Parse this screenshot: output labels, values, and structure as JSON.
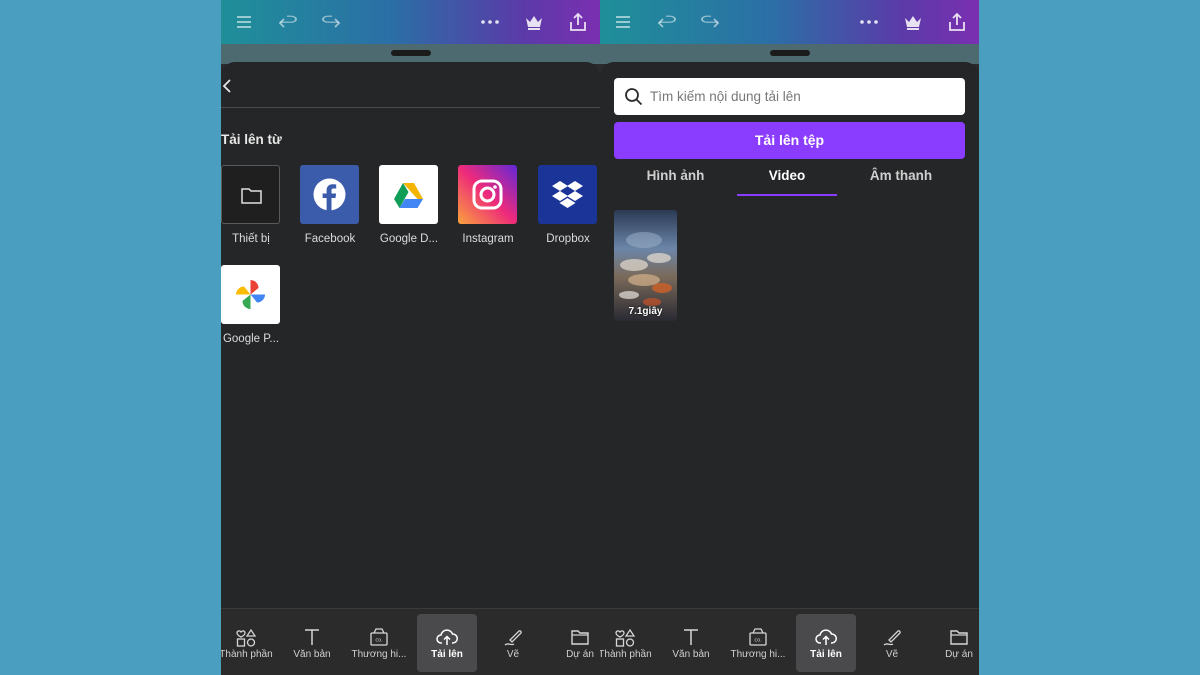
{
  "left_panel": {
    "section_title": "Tải lên từ",
    "sources": [
      {
        "label": "Thiết bị",
        "icon": "folder-icon"
      },
      {
        "label": "Facebook",
        "icon": "facebook-icon"
      },
      {
        "label": "Google D...",
        "icon": "google-drive-icon"
      },
      {
        "label": "Instagram",
        "icon": "instagram-icon"
      },
      {
        "label": "Dropbox",
        "icon": "dropbox-icon"
      },
      {
        "label": "Google P...",
        "icon": "google-photos-icon"
      }
    ]
  },
  "right_panel": {
    "search_placeholder": "Tìm kiếm nội dung tải lên",
    "upload_button": "Tải lên tệp",
    "tabs": [
      {
        "label": "Hình ảnh",
        "active": false
      },
      {
        "label": "Video",
        "active": true
      },
      {
        "label": "Âm thanh",
        "active": false
      }
    ],
    "videos": [
      {
        "duration": "7.1giây"
      }
    ]
  },
  "bottom_nav": {
    "items": [
      {
        "label": "Thành phần",
        "icon": "shapes-icon",
        "active": false
      },
      {
        "label": "Văn bản",
        "icon": "text-icon",
        "active": false
      },
      {
        "label": "Thương hi...",
        "icon": "brand-icon",
        "active": false
      },
      {
        "label": "Tải lên",
        "icon": "cloud-upload-icon",
        "active": true
      },
      {
        "label": "Vẽ",
        "icon": "draw-icon",
        "active": false
      },
      {
        "label": "Dự án",
        "icon": "folder-icon",
        "active": false
      }
    ]
  },
  "colors": {
    "accent": "#8b3dff",
    "background": "#4a9fc1",
    "sheet": "#252627"
  }
}
